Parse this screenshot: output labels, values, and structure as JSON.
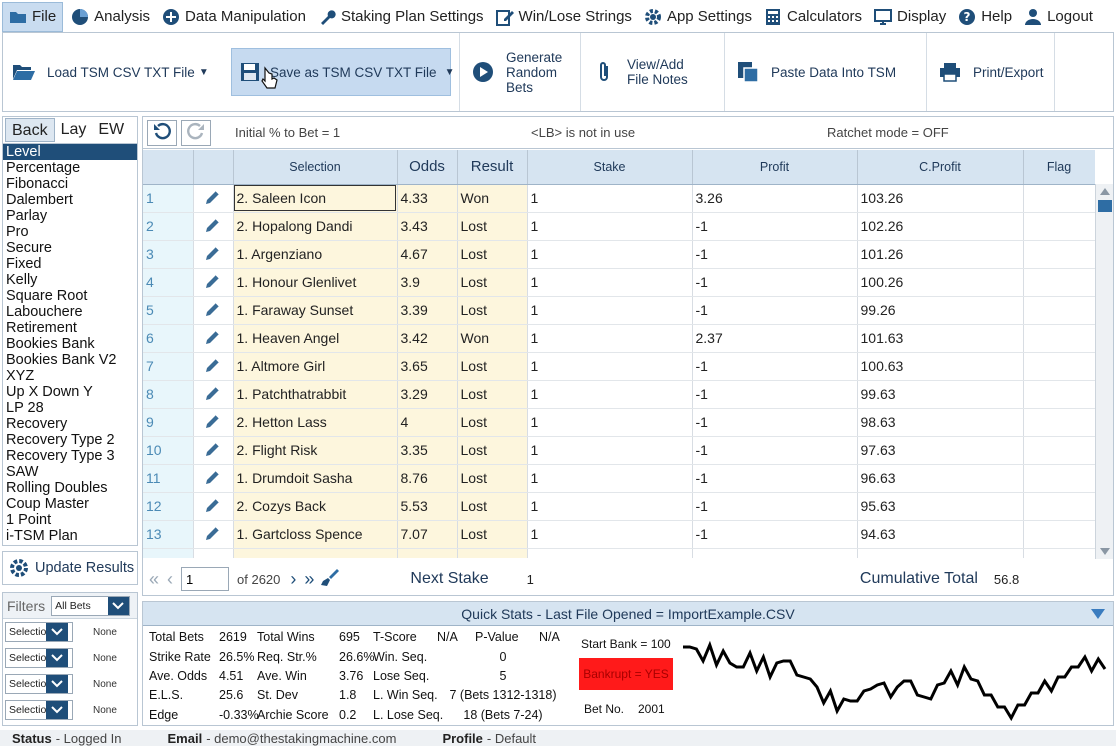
{
  "menu": [
    {
      "label": "File",
      "icon": "folder-icon",
      "active": true
    },
    {
      "label": "Analysis",
      "icon": "pie-chart-icon"
    },
    {
      "label": "Data Manipulation",
      "icon": "plus-circle-icon"
    },
    {
      "label": "Staking Plan Settings",
      "icon": "wrench-icon"
    },
    {
      "label": "Win/Lose Strings",
      "icon": "edit-icon"
    },
    {
      "label": "App Settings",
      "icon": "gear-icon"
    },
    {
      "label": "Calculators",
      "icon": "calculator-icon"
    },
    {
      "label": "Display",
      "icon": "monitor-icon"
    },
    {
      "label": "Help",
      "icon": "help-icon"
    },
    {
      "label": "Logout",
      "icon": "user-icon"
    }
  ],
  "toolbar": {
    "load": "Load TSM CSV TXT File",
    "save": "Save as TSM CSV TXT File",
    "generate": [
      "Generate",
      "Random",
      "Bets"
    ],
    "notes": [
      "View/Add",
      "File Notes"
    ],
    "paste": "Paste Data Into TSM",
    "print": "Print/Export"
  },
  "left": {
    "tabs": [
      "Back",
      "Lay",
      "EW"
    ],
    "plans": [
      "Level",
      "Percentage",
      "Fibonacci",
      "Dalembert",
      "Parlay",
      "Pro",
      "Secure",
      "Fixed",
      "Kelly",
      "Square Root",
      "Labouchere",
      "Retirement",
      "Bookies Bank",
      "Bookies Bank V2",
      "XYZ",
      "Up X Down Y",
      "LP 28",
      "Recovery",
      "Recovery Type 2",
      "Recovery Type 3",
      "SAW",
      "Rolling Doubles",
      "Coup Master",
      "1 Point",
      "i-TSM Plan"
    ],
    "selected_plan": "Level",
    "update_label": "Update Results"
  },
  "filters": {
    "title": "Filters",
    "all_bets": "All Bets",
    "rows": [
      {
        "select": "Selection",
        "value": "None"
      },
      {
        "select": "Selection",
        "value": "None"
      },
      {
        "select": "Selection",
        "value": "None"
      },
      {
        "select": "Selection",
        "value": "None"
      }
    ]
  },
  "info": {
    "initial": "Initial % to Bet = 1",
    "lb": "<LB> is not in use",
    "ratchet": "Ratchet mode = OFF"
  },
  "grid": {
    "headers": [
      "",
      "",
      "Selection",
      "Odds",
      "Result",
      "Stake",
      "Profit",
      "C.Profit",
      "Flag"
    ],
    "rows": [
      [
        "1",
        "2. Saleen Icon",
        "4.33",
        "Won",
        "1",
        "3.26",
        "103.26",
        ""
      ],
      [
        "2",
        "2. Hopalong Dandi",
        "3.43",
        "Lost",
        "1",
        "-1",
        "102.26",
        ""
      ],
      [
        "3",
        "1. Argenziano",
        "4.67",
        "Lost",
        "1",
        "-1",
        "101.26",
        ""
      ],
      [
        "4",
        "1. Honour Glenlivet",
        "3.9",
        "Lost",
        "1",
        "-1",
        "100.26",
        ""
      ],
      [
        "5",
        "1. Faraway Sunset",
        "3.39",
        "Lost",
        "1",
        "-1",
        "99.26",
        ""
      ],
      [
        "6",
        "1. Heaven Angel",
        "3.42",
        "Won",
        "1",
        "2.37",
        "101.63",
        ""
      ],
      [
        "7",
        "1. Altmore Girl",
        "3.65",
        "Lost",
        "1",
        "-1",
        "100.63",
        ""
      ],
      [
        "8",
        "1. Patchthatrabbit",
        "3.29",
        "Lost",
        "1",
        "-1",
        "99.63",
        ""
      ],
      [
        "9",
        "2. Hetton Lass",
        "4",
        "Lost",
        "1",
        "-1",
        "98.63",
        ""
      ],
      [
        "10",
        "2. Flight Risk",
        "3.35",
        "Lost",
        "1",
        "-1",
        "97.63",
        ""
      ],
      [
        "11",
        "1. Drumdoit Sasha",
        "8.76",
        "Lost",
        "1",
        "-1",
        "96.63",
        ""
      ],
      [
        "12",
        "2. Cozys Back",
        "5.53",
        "Lost",
        "1",
        "-1",
        "95.63",
        ""
      ],
      [
        "13",
        "1. Gartcloss Spence",
        "7.07",
        "Lost",
        "1",
        "-1",
        "94.63",
        ""
      ]
    ]
  },
  "pager": {
    "page": "1",
    "of": "of 2620",
    "next_stake_label": "Next Stake",
    "next_stake": "1",
    "cum_total_label": "Cumulative Total",
    "cum_total": "56.8"
  },
  "stats": {
    "title": "Quick Stats - Last File Opened = ImportExample.CSV",
    "col1": [
      [
        "Total Bets",
        "2619"
      ],
      [
        "Strike Rate",
        "26.5%"
      ],
      [
        "Ave. Odds",
        "4.51"
      ],
      [
        "E.L.S.",
        "25.6"
      ],
      [
        "Edge",
        "-0.33%"
      ]
    ],
    "col2": [
      [
        "Total Wins",
        "695"
      ],
      [
        "Req. Str.%",
        "26.6%"
      ],
      [
        "Ave. Win",
        "3.76"
      ],
      [
        "St. Dev",
        "1.8"
      ],
      [
        "Archie Score",
        "0.2"
      ]
    ],
    "col3": [
      [
        "T-Score",
        "N/A"
      ],
      [
        "Win. Seq.",
        ""
      ],
      [
        "Lose Seq.",
        ""
      ],
      [
        "L. Win Seq.",
        ""
      ],
      [
        "L. Lose Seq.",
        ""
      ]
    ],
    "col4": [
      [
        "P-Value",
        "N/A"
      ],
      [
        "",
        "0"
      ],
      [
        "",
        "5"
      ],
      [
        "",
        "7 (Bets 1312-1318)"
      ],
      [
        "",
        "18 (Bets 7-24)"
      ]
    ],
    "start_bank": "Start Bank = 100",
    "bankrupt": "Bankrupt = YES",
    "bet_no_label": "Bet No.",
    "bet_no": "2001"
  },
  "status": {
    "status_label": "Status",
    "status_value": "- Logged In",
    "email_label": "Email",
    "email_value": "- demo@thestakingmachine.com",
    "profile_label": "Profile",
    "profile_value": "- Default"
  },
  "colors": {
    "accent": "#1f4e79",
    "header": "#d6e4f1",
    "bankrupt": "#ff1a1a"
  }
}
